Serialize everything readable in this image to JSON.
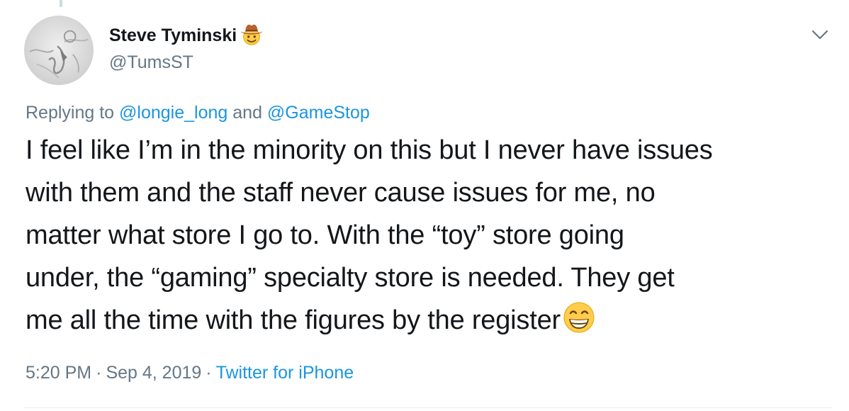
{
  "author": {
    "display_name": "Steve Tyminski",
    "name_emoji": "cowboy-hat-face-emoji",
    "username": "@TumsST"
  },
  "reply": {
    "prefix": "Replying to ",
    "mention_1": "@longie_long",
    "conjunction": " and ",
    "mention_2": "@GameStop"
  },
  "tweet": {
    "lines": [
      "I feel like I’m in the minority on this but I never have issues",
      "with them and the staff never cause issues for me, no",
      "matter what store I go to. With the “toy” store going",
      "under, the “gaming” specialty store is needed. They get",
      "me all the time with the figures by the register"
    ],
    "trailing_emoji": "grinning-face-with-smiling-eyes-emoji"
  },
  "meta": {
    "time": "5:20 PM",
    "separator": "·",
    "date": "Sep 4, 2019",
    "source": "Twitter for iPhone"
  },
  "icons": {
    "menu": "chevron-down-icon"
  },
  "colors": {
    "link": "#1b95e0",
    "secondary_text": "#657786",
    "primary_text": "#14171a",
    "divider": "#e6ecf0"
  }
}
